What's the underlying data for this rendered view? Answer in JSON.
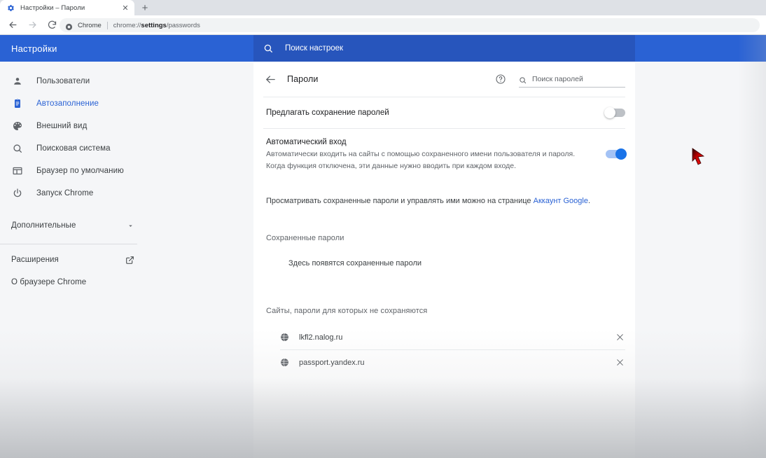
{
  "browser": {
    "tab": {
      "title": "Настройки – Пароли",
      "favicon": "settings-gear-icon",
      "close_label": "✕"
    },
    "new_tab_label": "+",
    "nav": {
      "back_label": "←",
      "forward_label": "→",
      "reload_label": "⟳"
    },
    "omnibox": {
      "chip_label": "Chrome",
      "url_prefix": "chrome://",
      "url_bold": "settings",
      "url_suffix": "/passwords",
      "icon": "chrome-globe-icon"
    }
  },
  "settings": {
    "app_title": "Настройки",
    "search": {
      "placeholder": "Поиск настроек",
      "icon": "search-icon"
    },
    "sidebar": {
      "items": [
        {
          "label": "Пользователи",
          "icon": "person-icon",
          "active": false
        },
        {
          "label": "Автозаполнение",
          "icon": "clipboard-icon",
          "active": true
        },
        {
          "label": "Внешний вид",
          "icon": "palette-icon",
          "active": false
        },
        {
          "label": "Поисковая система",
          "icon": "search-icon",
          "active": false
        },
        {
          "label": "Браузер по умолчанию",
          "icon": "window-icon",
          "active": false
        },
        {
          "label": "Запуск Chrome",
          "icon": "power-icon",
          "active": false
        }
      ],
      "advanced": {
        "label": "Дополнительные",
        "icon": "chevron-down-icon"
      },
      "links": [
        {
          "label": "Расширения",
          "icon": "external-link-icon"
        },
        {
          "label": "О браузере Chrome",
          "icon": ""
        }
      ]
    },
    "page": {
      "back_icon": "back-arrow-icon",
      "title": "Пароли",
      "help_icon": "help-circle-icon",
      "password_search": {
        "placeholder": "Поиск паролей",
        "icon": "search-icon"
      },
      "offer_save": {
        "title": "Предлагать сохранение паролей",
        "toggle_state": "off"
      },
      "auto_signin": {
        "title": "Автоматический вход",
        "sub_line1": "Автоматически входить на сайты с помощью сохраненного имени пользователя и пароля.",
        "sub_line2": "Когда функция отключена, эти данные нужно вводить при каждом входе.",
        "toggle_state": "on"
      },
      "manage": {
        "text": "Просматривать сохраненные пароли и управлять ими можно на странице ",
        "link_label": "Аккаунт Google",
        "text_after": "."
      },
      "saved_section": {
        "label": "Сохраненные пароли",
        "empty_text": "Здесь появятся сохраненные пароли"
      },
      "blocked_section": {
        "label": "Сайты, пароли для которых не сохраняются",
        "rows": [
          {
            "site": "lkfl2.nalog.ru",
            "icon": "globe-icon",
            "remove_label": "✕"
          },
          {
            "site": "passport.yandex.ru",
            "icon": "globe-icon",
            "remove_label": "✕"
          }
        ]
      }
    }
  },
  "colors": {
    "brand_blue": "#2a62d4",
    "topsearch_blue": "#2755bc",
    "accent_link": "#2a62d4",
    "toggle_on": "#1a73e8",
    "toggle_off": "#bdc1c6",
    "page_bg": "#f5f6f8",
    "cursor_red": "#d01010"
  }
}
